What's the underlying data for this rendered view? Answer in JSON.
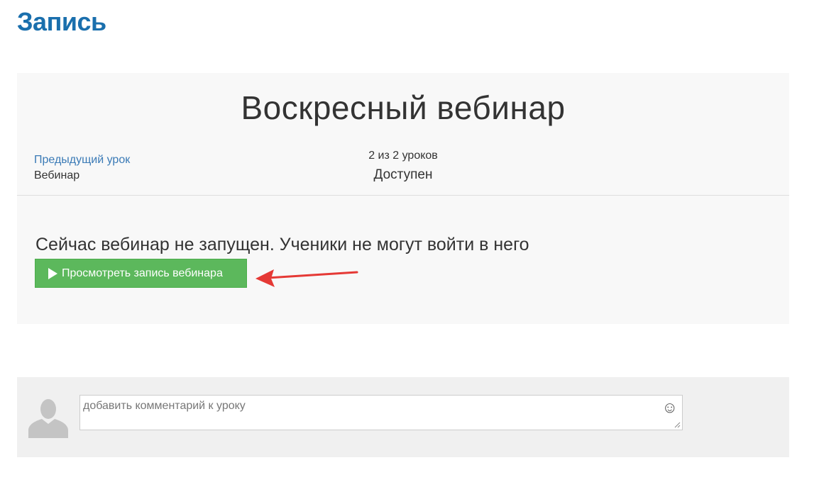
{
  "page": {
    "title": "Запись"
  },
  "lesson": {
    "heading": "Воскресный вебинар",
    "prev_link_label": "Предыдущий урок",
    "prev_lesson_name": "Вебинар",
    "progress_count": "2 из 2 уроков",
    "status": "Доступен"
  },
  "webinar": {
    "message": "Сейчас вебинар не запущен. Ученики не могут войти в него",
    "view_button_label": "Просмотреть запись вебинара"
  },
  "comment": {
    "placeholder": "добавить комментарий к уроку",
    "emoji_icon": "☺"
  },
  "colors": {
    "title": "#1a6fad",
    "link": "#3a7ab6",
    "button": "#5cb85c",
    "arrow": "#e53935",
    "panel": "#f8f8f8",
    "comment_panel": "#f0f0f0"
  },
  "icons": {
    "play": "play-icon",
    "avatar": "user-avatar-icon",
    "emoji": "smiley-icon",
    "annotation": "red-arrow-icon"
  }
}
